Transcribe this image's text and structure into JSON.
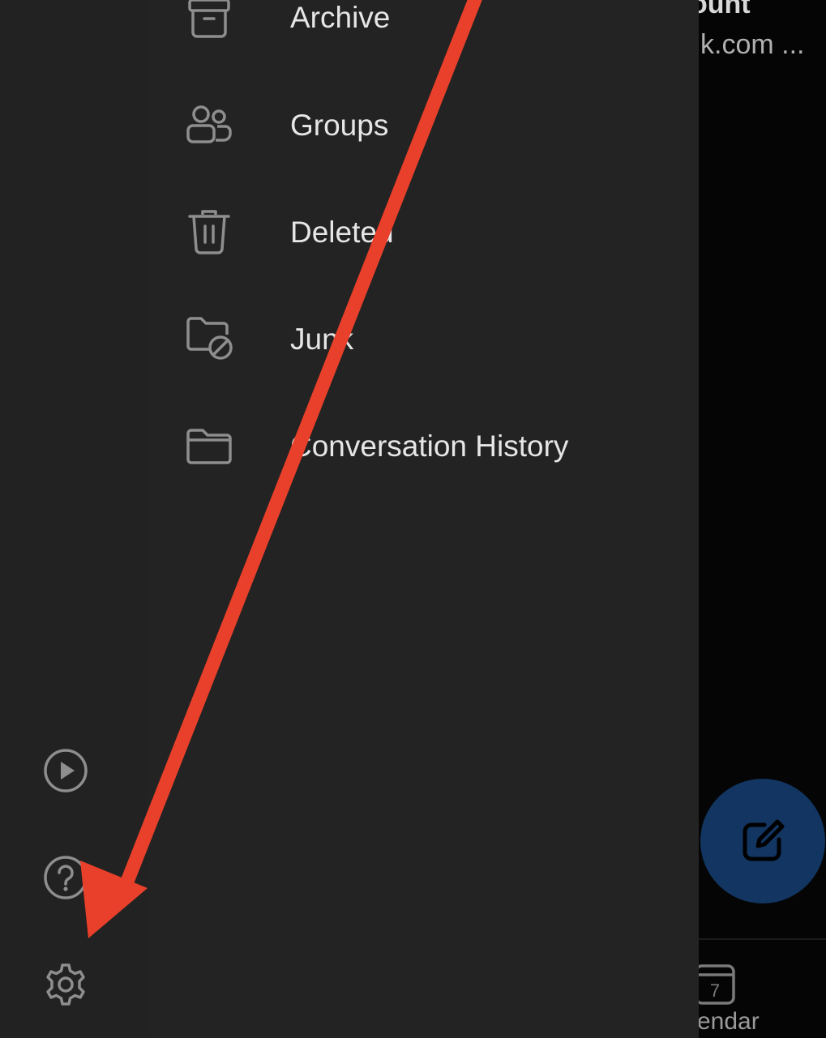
{
  "background_app": {
    "title_fragment": "ount",
    "subtitle_fragment": "k.com ...",
    "calendar_date": "7",
    "calendar_label": "endar"
  },
  "drawer": {
    "folders": [
      {
        "label": "Archive",
        "icon": "archive-icon"
      },
      {
        "label": "Groups",
        "icon": "groups-icon"
      },
      {
        "label": "Deleted",
        "icon": "trash-icon"
      },
      {
        "label": "Junk",
        "icon": "junk-folder-icon"
      },
      {
        "label": "Conversation History",
        "icon": "folder-icon"
      }
    ]
  },
  "rail": {
    "items": [
      {
        "icon": "play-icon"
      },
      {
        "icon": "help-icon"
      },
      {
        "icon": "gear-icon"
      }
    ]
  },
  "fab": {
    "icon": "compose-icon"
  },
  "colors": {
    "rail_bg": "#222222",
    "drawer_bg": "#232323",
    "text": "#e6e6e6",
    "icon": "#8e8e8e",
    "fab_bg": "#123561",
    "annotation_arrow": "#e8402a"
  }
}
